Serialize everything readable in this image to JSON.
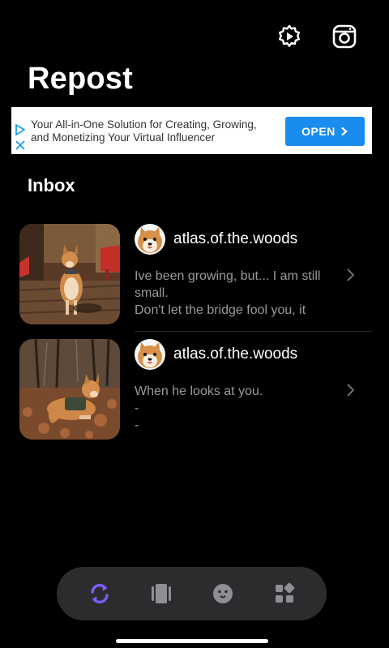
{
  "header": {
    "title": "Repost",
    "icons": [
      "settings-gear-icon",
      "instagram-icon"
    ]
  },
  "ad": {
    "text_line1": "Your All-in-One Solution for Creating, Growing,",
    "text_line2": "and Monetizing Your Virtual Influencer",
    "button_label": "OPEN",
    "icons": [
      "ad-choices-icon",
      "ad-close-icon"
    ],
    "button_color": "#1a8cf0"
  },
  "inbox": {
    "heading": "Inbox",
    "items": [
      {
        "username": "atlas.of.the.woods",
        "caption": [
          "Ive been growing, but... I am still",
          "small.",
          "Don't let the bridge fool you, it"
        ]
      },
      {
        "username": "atlas.of.the.woods",
        "caption": [
          "When he looks at you.",
          "-",
          "-"
        ]
      }
    ]
  },
  "tabbar": {
    "tabs": [
      "repost-icon",
      "carousel-icon",
      "face-icon",
      "widgets-icon"
    ],
    "active_color": "#7d5cf5",
    "inactive_color": "#8e8e93"
  }
}
